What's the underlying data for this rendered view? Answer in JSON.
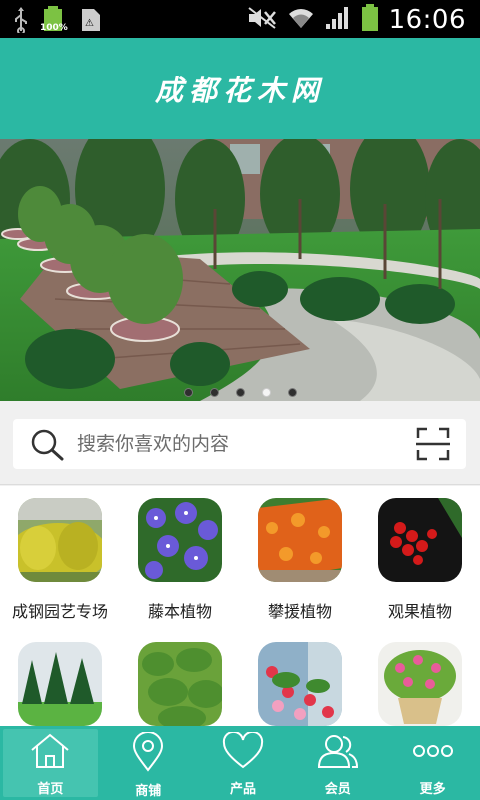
{
  "status_bar": {
    "time": "16:06",
    "battery_left_label": "100%",
    "icons": [
      "usb-icon",
      "battery-full-icon",
      "sim-icon",
      "mute-icon",
      "wifi-icon",
      "signal-icon",
      "battery-icon"
    ]
  },
  "header": {
    "title": "成都花木网"
  },
  "banner": {
    "slide_count": 5,
    "active_index": 3
  },
  "search": {
    "placeholder": "搜索你喜欢的内容"
  },
  "categories": [
    {
      "label": "成钢园艺专场"
    },
    {
      "label": "藤本植物"
    },
    {
      "label": "攀援植物"
    },
    {
      "label": "观果植物"
    },
    {
      "label": ""
    },
    {
      "label": ""
    },
    {
      "label": ""
    },
    {
      "label": ""
    }
  ],
  "tabs": [
    {
      "label": "首页",
      "icon": "home-icon",
      "active": true
    },
    {
      "label": "商铺",
      "icon": "location-pin-icon",
      "active": false
    },
    {
      "label": "产品",
      "icon": "heart-icon",
      "active": false
    },
    {
      "label": "会员",
      "icon": "members-icon",
      "active": false
    },
    {
      "label": "更多",
      "icon": "more-icon",
      "active": false
    }
  ],
  "colors": {
    "brand": "#2bb8a3",
    "status_bar": "#000000"
  }
}
